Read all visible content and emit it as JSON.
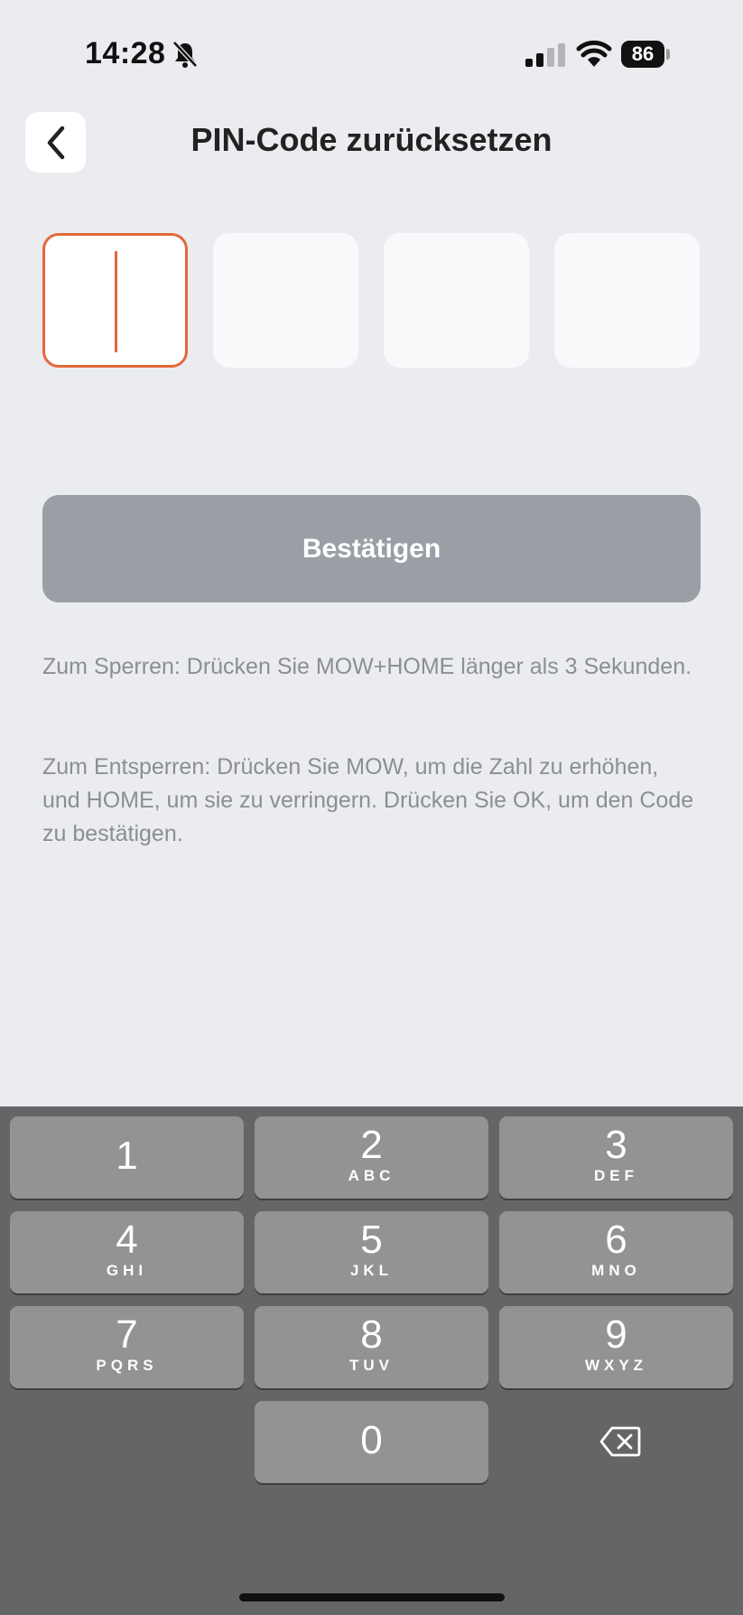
{
  "status_bar": {
    "time": "14:28",
    "battery": "86",
    "icons": [
      "bell-slash-icon",
      "signal-icon",
      "wifi-icon",
      "battery-icon"
    ]
  },
  "header": {
    "title": "PIN-Code zurücksetzen",
    "back_icon": "chevron-left-icon"
  },
  "pin": {
    "digits": [
      "",
      "",
      "",
      ""
    ],
    "active_index": 0,
    "accent_color": "#e2693a"
  },
  "confirm": {
    "label": "Bestätigen",
    "color": "#9a9fa6"
  },
  "instructions": {
    "lock": "Zum Sperren: Drücken Sie MOW+HOME länger als 3 Sekunden.",
    "unlock": "Zum Entsperren: Drücken Sie MOW, um die Zahl zu erhöhen, und HOME, um sie zu verringern. Drücken Sie OK, um den Code zu bestätigen."
  },
  "keypad": {
    "keys": [
      {
        "digit": "1",
        "letters": ""
      },
      {
        "digit": "2",
        "letters": "ABC"
      },
      {
        "digit": "3",
        "letters": "DEF"
      },
      {
        "digit": "4",
        "letters": "GHI"
      },
      {
        "digit": "5",
        "letters": "JKL"
      },
      {
        "digit": "6",
        "letters": "MNO"
      },
      {
        "digit": "7",
        "letters": "PQRS"
      },
      {
        "digit": "8",
        "letters": "TUV"
      },
      {
        "digit": "9",
        "letters": "WXYZ"
      },
      {
        "digit": "0",
        "letters": ""
      }
    ],
    "backspace_icon": "backspace-icon"
  }
}
